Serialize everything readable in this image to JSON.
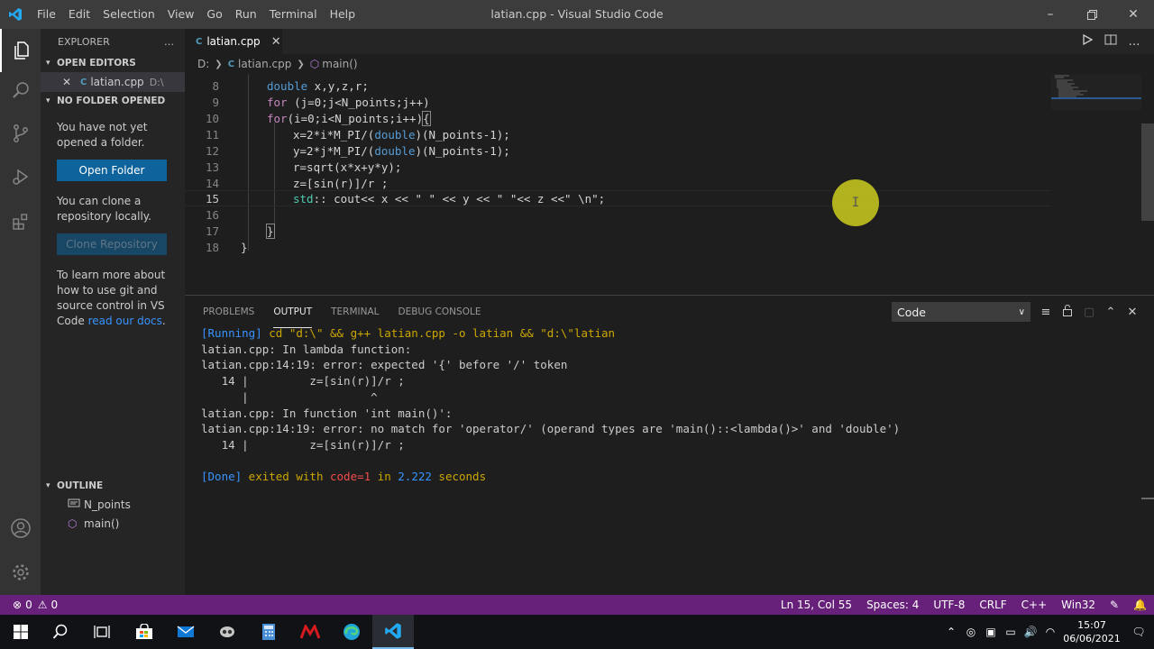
{
  "titlebar": {
    "menu": [
      "File",
      "Edit",
      "Selection",
      "View",
      "Go",
      "Run",
      "Terminal",
      "Help"
    ],
    "title": "latian.cpp - Visual Studio Code"
  },
  "sidebar": {
    "header": "EXPLORER",
    "open_editors": {
      "title": "OPEN EDITORS",
      "items": [
        {
          "name": "latian.cpp",
          "dir": "D:\\"
        }
      ]
    },
    "no_folder": {
      "title": "NO FOLDER OPENED",
      "text1": "You have not yet opened a folder.",
      "open_folder": "Open Folder",
      "text2": "You can clone a repository locally.",
      "clone": "Clone Repository",
      "text3": "To learn more about how to use git and source control in VS Code",
      "link": "read our docs",
      "text3_end": "."
    },
    "outline": {
      "title": "OUTLINE",
      "items": [
        "N_points",
        "main()"
      ]
    }
  },
  "editor": {
    "tab": "latian.cpp",
    "breadcrumb": [
      "D:",
      "latian.cpp",
      "main()"
    ],
    "lines": [
      {
        "n": "8",
        "text": "double x,y,z,r;"
      },
      {
        "n": "9",
        "text": "for (j=0;j<N_points;j++)"
      },
      {
        "n": "10",
        "text": "for(i=0;i<N_points;i++){"
      },
      {
        "n": "11",
        "text": "x=2*i*M_PI/(double)(N_points-1);"
      },
      {
        "n": "12",
        "text": "y=2*j*M_PI/(double)(N_points-1);"
      },
      {
        "n": "13",
        "text": "r=sqrt(x*x+y*y);"
      },
      {
        "n": "14",
        "text": "z=[sin(r)]/r ;"
      },
      {
        "n": "15",
        "text": "std:: cout<< x << \" \" << y << \" \"<< z <<\" \\n\";"
      },
      {
        "n": "16",
        "text": ""
      },
      {
        "n": "17",
        "text": "}"
      },
      {
        "n": "18",
        "text": "}"
      }
    ]
  },
  "panel": {
    "tabs": [
      "PROBLEMS",
      "OUTPUT",
      "TERMINAL",
      "DEBUG CONSOLE"
    ],
    "active_tab": "OUTPUT",
    "channel": "Code",
    "output": {
      "running_tag": "[Running]",
      "running_cmd": " cd \"d:\\\" && g++ latian.cpp -o latian && \"d:\\\"latian",
      "l2": "latian.cpp: In lambda function:",
      "l3": "latian.cpp:14:19: error: expected '{' before '/' token",
      "l4": "   14 |         z=[sin(r)]/r ;",
      "l5": "      |                  ^",
      "l6": "latian.cpp: In function 'int main()':",
      "l7": "latian.cpp:14:19: error: no match for 'operator/' (operand types are 'main()::<lambda()>' and 'double')",
      "l8": "   14 |         z=[sin(r)]/r ;",
      "done_tag": "[Done]",
      "done_1": " exited with ",
      "done_code": "code=1",
      "done_2": " in ",
      "done_secs": "2.222",
      "done_3": " seconds"
    }
  },
  "statusbar": {
    "errors": "0",
    "warnings": "0",
    "position": "Ln 15, Col 55",
    "spaces": "Spaces: 4",
    "encoding": "UTF-8",
    "eol": "CRLF",
    "language": "C++",
    "platform": "Win32"
  },
  "taskbar": {
    "time": "15:07",
    "date": "06/06/2021"
  },
  "colors": {
    "statusbar": "#68217a",
    "accent": "#0e639c",
    "error": "#f14c4c",
    "link": "#3794ff"
  }
}
